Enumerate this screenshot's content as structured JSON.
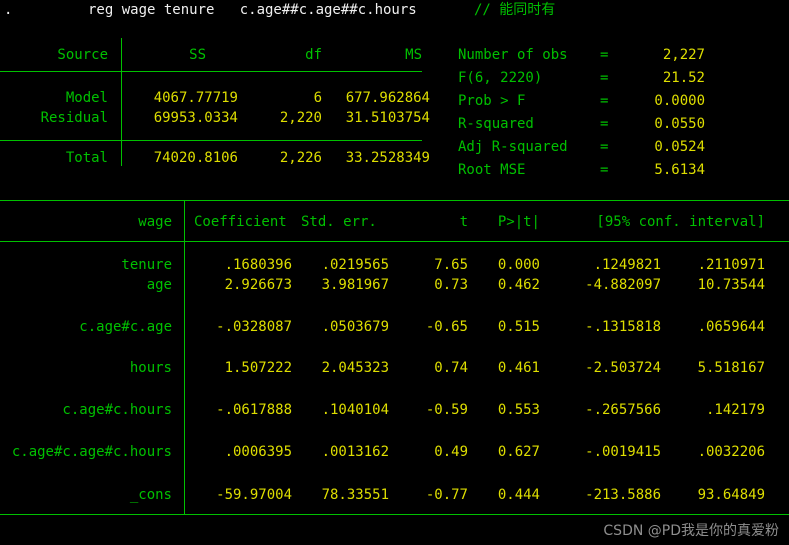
{
  "terminal": {
    "background_color": "#000000",
    "keyword_color": "#00c000",
    "value_color": "#dede00",
    "command_color": "#f0f0f0",
    "watermark_color": "#8e8e8e"
  },
  "command_line": {
    "prompt": ".",
    "command": "reg wage tenure   c.age##c.age##c.hours",
    "comment": "// 能同时有"
  },
  "anova": {
    "headers": {
      "source": "Source",
      "ss": "SS",
      "df": "df",
      "ms": "MS"
    },
    "rows": [
      {
        "source": "Model",
        "ss": "4067.77719",
        "df": "6",
        "ms": "677.962864"
      },
      {
        "source": "Residual",
        "ss": "69953.0334",
        "df": "2,220",
        "ms": "31.5103754"
      }
    ],
    "total": {
      "source": "Total",
      "ss": "74020.8106",
      "df": "2,226",
      "ms": "33.2528349"
    }
  },
  "model_stats": [
    {
      "label": "Number of obs",
      "eq": "=",
      "value": "2,227"
    },
    {
      "label": "F(6, 2220)",
      "eq": "=",
      "value": "21.52"
    },
    {
      "label": "Prob > F",
      "eq": "=",
      "value": "0.0000"
    },
    {
      "label": "R-squared",
      "eq": "=",
      "value": "0.0550"
    },
    {
      "label": "Adj R-squared",
      "eq": "=",
      "value": "0.0524"
    },
    {
      "label": "Root MSE",
      "eq": "=",
      "value": "5.6134"
    }
  ],
  "coef_table": {
    "headers": {
      "depvar": "wage",
      "coef": "Coefficient",
      "stderr": "Std. err.",
      "t": "t",
      "p": "P>|t|",
      "ci": "[95% conf. interval]"
    },
    "rows": [
      {
        "term": "tenure",
        "coef": ".1680396",
        "stderr": ".0219565",
        "t": "7.65",
        "p": "0.000",
        "ci_low": ".1249821",
        "ci_high": ".2110971"
      },
      {
        "term": "age",
        "coef": "2.926673",
        "stderr": "3.981967",
        "t": "0.73",
        "p": "0.462",
        "ci_low": "-4.882097",
        "ci_high": "10.73544"
      },
      {
        "term": "c.age#c.age",
        "coef": "-.0328087",
        "stderr": ".0503679",
        "t": "-0.65",
        "p": "0.515",
        "ci_low": "-.1315818",
        "ci_high": ".0659644"
      },
      {
        "term": "hours",
        "coef": "1.507222",
        "stderr": "2.045323",
        "t": "0.74",
        "p": "0.461",
        "ci_low": "-2.503724",
        "ci_high": "5.518167"
      },
      {
        "term": "c.age#c.hours",
        "coef": "-.0617888",
        "stderr": ".1040104",
        "t": "-0.59",
        "p": "0.553",
        "ci_low": "-.2657566",
        "ci_high": ".142179"
      },
      {
        "term": "c.age#c.age#c.hours",
        "coef": ".0006395",
        "stderr": ".0013162",
        "t": "0.49",
        "p": "0.627",
        "ci_low": "-.0019415",
        "ci_high": ".0032206"
      },
      {
        "term": "_cons",
        "coef": "-59.97004",
        "stderr": "78.33551",
        "t": "-0.77",
        "p": "0.444",
        "ci_low": "-213.5886",
        "ci_high": "93.64849"
      }
    ]
  },
  "watermark": {
    "text": "CSDN @PD我是你的真爱粉"
  }
}
